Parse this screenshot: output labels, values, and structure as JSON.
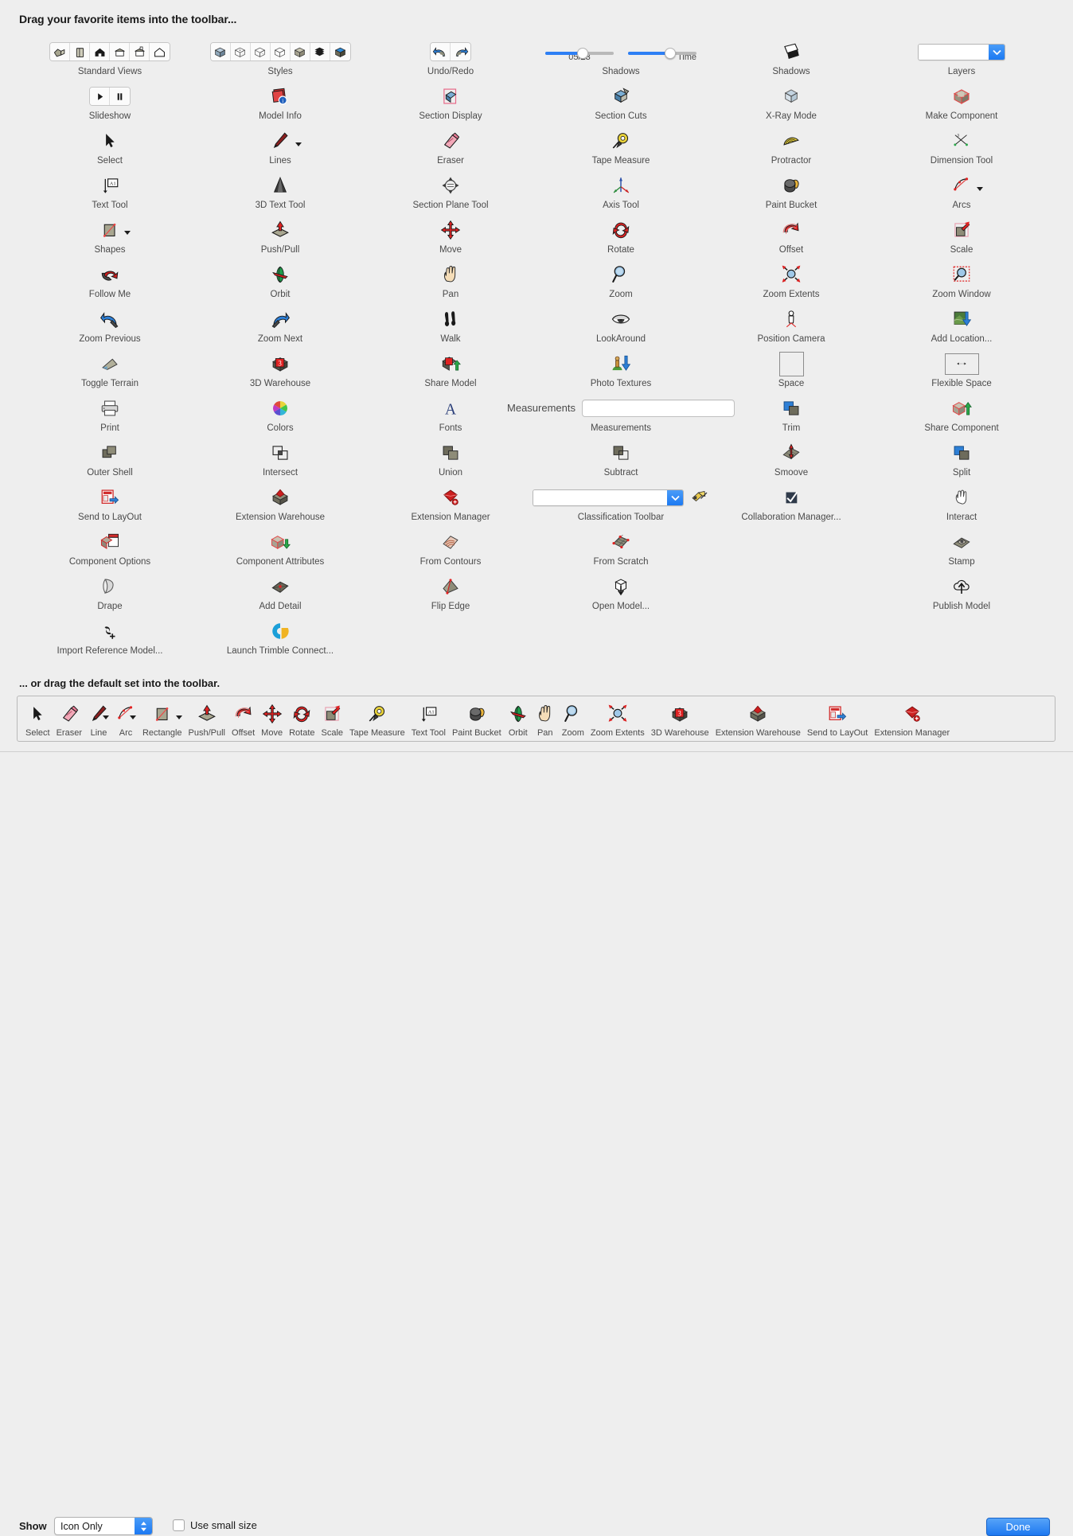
{
  "header": {
    "title": "Drag your favorite items into the toolbar..."
  },
  "subtitle": "... or drag the default set into the toolbar.",
  "shadows_slider": {
    "date_label": "05/23",
    "time_label": "Time",
    "date_pct": 55,
    "time_pct": 62
  },
  "measurements": {
    "label": "Measurements",
    "value": "",
    "caption": "Measurements"
  },
  "classification": {
    "value": "",
    "caption": "Classification Toolbar"
  },
  "layers": {
    "value": "",
    "caption": "Layers"
  },
  "footer": {
    "show_label": "Show",
    "show_value": "Icon Only",
    "small_size_label": "Use small size",
    "small_size_checked": false,
    "done_label": "Done"
  },
  "colors": {
    "background": "#eeeeee",
    "accent_blue": "#1c79f2",
    "slider_fill": "#2d7ff5",
    "caption_text": "#4a4a4a"
  },
  "palette": {
    "columns": [
      [
        {
          "label": "Standard Views",
          "icon": "standard-views-group"
        },
        {
          "label": "Slideshow",
          "icon": "slideshow-group"
        },
        {
          "label": "Select",
          "icon": "select-arrow"
        },
        {
          "label": "Text Tool",
          "icon": "text-tool"
        },
        {
          "label": "Shapes",
          "icon": "shapes",
          "caret": true
        },
        {
          "label": "Follow Me",
          "icon": "follow-me"
        },
        {
          "label": "Zoom Previous",
          "icon": "zoom-previous"
        },
        {
          "label": "Toggle Terrain",
          "icon": "toggle-terrain"
        },
        {
          "label": "Print",
          "icon": "print"
        },
        {
          "label": "Outer Shell",
          "icon": "outer-shell"
        },
        {
          "label": "Send to LayOut",
          "icon": "send-to-layout"
        },
        {
          "label": "Component Options",
          "icon": "component-options"
        },
        {
          "label": "Drape",
          "icon": "drape"
        },
        {
          "label": "Import Reference Model...",
          "icon": "import-reference-model"
        }
      ],
      [
        {
          "label": "Styles",
          "icon": "styles-group"
        },
        {
          "label": "Model Info",
          "icon": "model-info"
        },
        {
          "label": "Lines",
          "icon": "lines",
          "caret": true
        },
        {
          "label": "3D Text Tool",
          "icon": "3d-text-tool"
        },
        {
          "label": "Push/Pull",
          "icon": "push-pull"
        },
        {
          "label": "Orbit",
          "icon": "orbit"
        },
        {
          "label": "Zoom Next",
          "icon": "zoom-next"
        },
        {
          "label": "3D Warehouse",
          "icon": "3d-warehouse"
        },
        {
          "label": "Colors",
          "icon": "colors"
        },
        {
          "label": "Intersect",
          "icon": "intersect"
        },
        {
          "label": "Extension Warehouse",
          "icon": "extension-warehouse"
        },
        {
          "label": "Component Attributes",
          "icon": "component-attributes"
        },
        {
          "label": "Add Detail",
          "icon": "add-detail"
        },
        {
          "label": "Launch Trimble Connect...",
          "icon": "trimble-connect"
        }
      ],
      [
        {
          "label": "Undo/Redo",
          "icon": "undo-redo-group"
        },
        {
          "label": "Section Display",
          "icon": "section-display"
        },
        {
          "label": "Eraser",
          "icon": "eraser"
        },
        {
          "label": "Section Plane Tool",
          "icon": "section-plane-tool"
        },
        {
          "label": "Move",
          "icon": "move"
        },
        {
          "label": "Pan",
          "icon": "pan"
        },
        {
          "label": "Walk",
          "icon": "walk"
        },
        {
          "label": "Share Model",
          "icon": "share-model"
        },
        {
          "label": "Fonts",
          "icon": "fonts"
        },
        {
          "label": "Union",
          "icon": "union"
        },
        {
          "label": "Extension Manager",
          "icon": "extension-manager"
        },
        {
          "label": "From Contours",
          "icon": "from-contours"
        },
        {
          "label": "Flip Edge",
          "icon": "flip-edge"
        }
      ],
      [
        {
          "label": "Shadows",
          "icon": "shadows-sliders"
        },
        {
          "label": "Section Cuts",
          "icon": "section-cuts"
        },
        {
          "label": "Tape Measure",
          "icon": "tape-measure"
        },
        {
          "label": "Axis Tool",
          "icon": "axis-tool"
        },
        {
          "label": "Rotate",
          "icon": "rotate"
        },
        {
          "label": "Zoom",
          "icon": "zoom"
        },
        {
          "label": "LookAround",
          "icon": "look-around"
        },
        {
          "label": "Photo Textures",
          "icon": "photo-textures"
        },
        {
          "label": "Measurements",
          "icon": "measurements-field"
        },
        {
          "label": "Subtract",
          "icon": "subtract"
        },
        {
          "label": "Classification Toolbar",
          "icon": "classification-field"
        },
        {
          "label": "From Scratch",
          "icon": "from-scratch"
        },
        {
          "label": "Open Model...",
          "icon": "open-model"
        }
      ],
      [
        {
          "label": "Shadows",
          "icon": "shadows-toggle"
        },
        {
          "label": "X-Ray Mode",
          "icon": "xray-mode"
        },
        {
          "label": "Protractor",
          "icon": "protractor"
        },
        {
          "label": "Paint Bucket",
          "icon": "paint-bucket"
        },
        {
          "label": "Offset",
          "icon": "offset"
        },
        {
          "label": "Zoom Extents",
          "icon": "zoom-extents"
        },
        {
          "label": "Position Camera",
          "icon": "position-camera"
        },
        {
          "label": "Space",
          "icon": "space"
        },
        {
          "label": "Trim",
          "icon": "trim"
        },
        {
          "label": "Smoove",
          "icon": "smoove"
        },
        {
          "label": "Collaboration Manager...",
          "icon": "collaboration-manager"
        }
      ],
      [
        {
          "label": "Layers",
          "icon": "layers-combo"
        },
        {
          "label": "Make Component",
          "icon": "make-component"
        },
        {
          "label": "Dimension Tool",
          "icon": "dimension-tool"
        },
        {
          "label": "Arcs",
          "icon": "arcs",
          "caret": true
        },
        {
          "label": "Scale",
          "icon": "scale"
        },
        {
          "label": "Zoom Window",
          "icon": "zoom-window"
        },
        {
          "label": "Add Location...",
          "icon": "add-location"
        },
        {
          "label": "Flexible Space",
          "icon": "flexible-space"
        },
        {
          "label": "Share Component",
          "icon": "share-component"
        },
        {
          "label": "Split",
          "icon": "split"
        },
        {
          "label": "Interact",
          "icon": "interact"
        },
        {
          "label": "Stamp",
          "icon": "stamp"
        },
        {
          "label": "Publish Model",
          "icon": "publish-model"
        }
      ]
    ]
  },
  "default_set": [
    {
      "label": "Select",
      "icon": "select-arrow"
    },
    {
      "label": "Eraser",
      "icon": "eraser"
    },
    {
      "label": "Line",
      "icon": "lines",
      "caret": true
    },
    {
      "label": "Arc",
      "icon": "arcs",
      "caret": true
    },
    {
      "label": "Rectangle",
      "icon": "shapes",
      "caret": true
    },
    {
      "label": "Push/Pull",
      "icon": "push-pull"
    },
    {
      "label": "Offset",
      "icon": "offset"
    },
    {
      "label": "Move",
      "icon": "move"
    },
    {
      "label": "Rotate",
      "icon": "rotate"
    },
    {
      "label": "Scale",
      "icon": "scale"
    },
    {
      "label": "Tape Measure",
      "icon": "tape-measure"
    },
    {
      "label": "Text Tool",
      "icon": "text-tool"
    },
    {
      "label": "Paint Bucket",
      "icon": "paint-bucket"
    },
    {
      "label": "Orbit",
      "icon": "orbit"
    },
    {
      "label": "Pan",
      "icon": "pan"
    },
    {
      "label": "Zoom",
      "icon": "zoom"
    },
    {
      "label": "Zoom Extents",
      "icon": "zoom-extents"
    },
    {
      "label": "3D Warehouse",
      "icon": "3d-warehouse"
    },
    {
      "label": "Extension Warehouse",
      "icon": "extension-warehouse"
    },
    {
      "label": "Send to LayOut",
      "icon": "send-to-layout"
    },
    {
      "label": "Extension Manager",
      "icon": "extension-manager"
    }
  ]
}
